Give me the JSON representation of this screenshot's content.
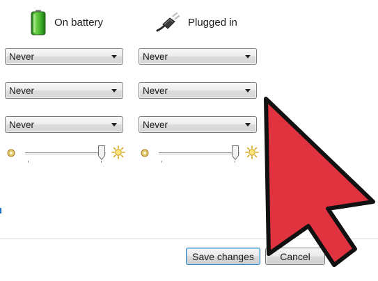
{
  "columns": {
    "battery": {
      "label": "On battery",
      "icon": "battery-icon",
      "settings": [
        "Never",
        "Never",
        "Never"
      ]
    },
    "plugged": {
      "label": "Plugged in",
      "icon": "power-plug-icon",
      "settings": [
        "Never",
        "Never",
        "Never"
      ]
    }
  },
  "brightness": {
    "battery_level": 0.95,
    "plugged_level": 0.95
  },
  "footer": {
    "save_label": "Save changes",
    "cancel_label": "Cancel"
  },
  "overlay": {
    "icon": "pointer-arrow-icon",
    "color": "#e0333f"
  },
  "colors": {
    "battery_green": "#3fae2a",
    "dropdown_border": "#7a7a7a",
    "save_focus_border": "#3c7fb1"
  }
}
